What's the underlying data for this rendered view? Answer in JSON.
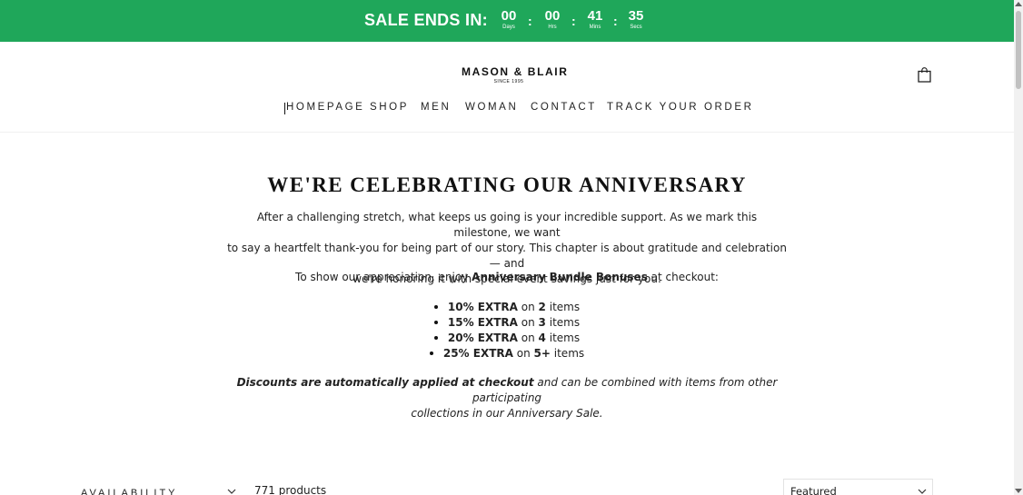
{
  "sale_bar": {
    "title": "SALE ENDS IN:",
    "countdown": [
      {
        "value": "00",
        "label": "Days"
      },
      {
        "value": "00",
        "label": "Hrs"
      },
      {
        "value": "41",
        "label": "Mins"
      },
      {
        "value": "35",
        "label": "Secs"
      }
    ],
    "separator": ":",
    "color": "#1fa75a"
  },
  "header": {
    "logo": "MASON & BLAIR",
    "logo_sub": "SINCE 1995",
    "cart_icon": "shopping-bag-icon"
  },
  "nav": {
    "items": [
      "HOMEPAGE",
      "SHOP",
      "MEN",
      "WOMAN",
      "CONTACT",
      "TRACK YOUR ORDER"
    ]
  },
  "content": {
    "title": "WE'RE CELEBRATING OUR ANNIVERSARY",
    "intro_lines": [
      "After a challenging stretch, what keeps us going is your incredible support. As we mark this milestone, we want",
      "to say a heartfelt thank-you for being part of our story. This chapter is about gratitude and celebration — and",
      "we're honoring it with special event savings just for you."
    ],
    "appreciation": {
      "before": "To show our appreciation, enjoy",
      "bold": "Anniversary Bundle Bonuses",
      "after": "at checkout:"
    },
    "bullets": [
      {
        "discount": "10% EXTRA",
        "on": "on",
        "qty": "2",
        "unit": "items"
      },
      {
        "discount": "15% EXTRA",
        "on": "on",
        "qty": "3",
        "unit": "items"
      },
      {
        "discount": "20% EXTRA",
        "on": "on",
        "qty": "4",
        "unit": "items"
      },
      {
        "discount": "25% EXTRA",
        "on": "on",
        "qty": "5+",
        "unit": "items"
      }
    ],
    "note": {
      "bold": "Discounts are automatically applied at checkout",
      "rest_line1": "and can be combined with items from other participating",
      "line2": "collections in our Anniversary Sale."
    }
  },
  "filters": {
    "availability_label": "AVAILABILITY",
    "product_count": "771 products",
    "sort_value": "Featured"
  }
}
